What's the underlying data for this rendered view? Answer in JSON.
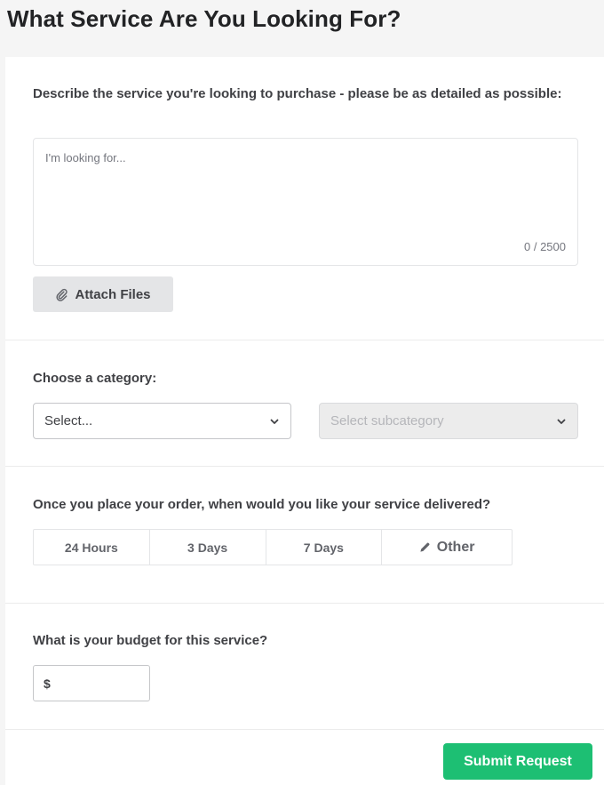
{
  "page": {
    "title": "What Service Are You Looking For?"
  },
  "description": {
    "label": "Describe the service you're looking to purchase - please be as detailed as possible:",
    "placeholder": "I'm looking for...",
    "value": "",
    "char_count": "0 / 2500",
    "attach_label": "Attach Files"
  },
  "category": {
    "label": "Choose a category:",
    "selected": "Select...",
    "subcategory_placeholder": "Select subcategory"
  },
  "delivery": {
    "label": "Once you place your order, when would you like your service delivered?",
    "options": [
      "24 Hours",
      "3 Days",
      "7 Days",
      "Other"
    ]
  },
  "budget": {
    "label": "What is your budget for this service?",
    "currency": "$",
    "value": ""
  },
  "submit": {
    "label": "Submit Request"
  },
  "colors": {
    "accent": "#1dbf73",
    "text": "#404145",
    "muted": "#74767e"
  },
  "icons": {
    "attach": "paperclip-icon",
    "select": "chevron-down-icon",
    "other": "pencil-icon"
  }
}
